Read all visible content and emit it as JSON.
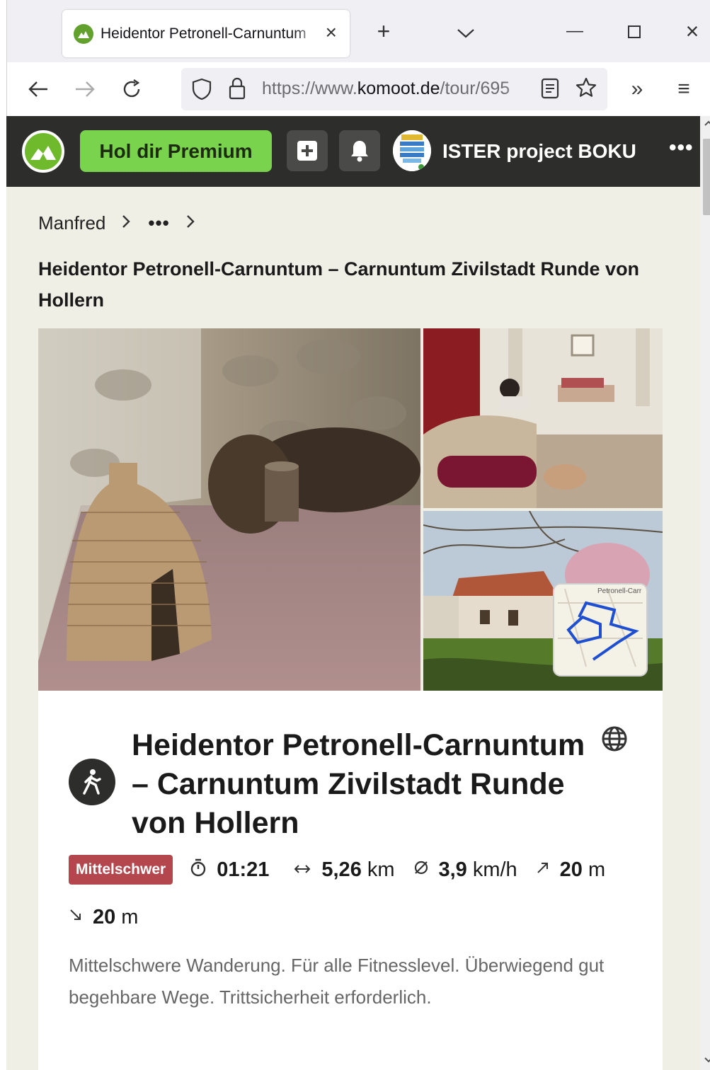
{
  "browser": {
    "tab_title": "Heidentor Petronell-Carnuntum",
    "tab_close": "×",
    "new_tab": "+",
    "list_tabs": "⌄",
    "minimize": "—",
    "maximize": "☐",
    "close": "×",
    "url_prefix": "https://www.",
    "url_domain": "komoot.de",
    "url_path": "/tour/695",
    "overflow": "»",
    "menu": "≡"
  },
  "header": {
    "premium_label": "Hol dir Premium",
    "user_name": "ISTER project BOKU",
    "more_label": "•••"
  },
  "breadcrumb": {
    "item1": "Manfred",
    "ellipsis": "•••"
  },
  "page_title": "Heidentor Petronell-Carnuntum – Carnuntum Zivilstadt Runde von Hollern",
  "map_label": "Petronell-Carr",
  "tour": {
    "title": "Heidentor Petronell-Carnuntum – Carnuntum Zivilstadt Runde von Hollern",
    "difficulty": "Mittelschwer",
    "duration_value": "01:21",
    "distance_value": "5,26",
    "distance_unit": "km",
    "speed_value": "3,9",
    "speed_unit": "km/h",
    "uphill_value": "20",
    "uphill_unit": "m",
    "downhill_value": "20",
    "downhill_unit": "m",
    "description": "Mittelschwere Wanderung. Für alle Fitnesslevel. Überwiegend gut begehbare Wege. Trittsicherheit erforderlich."
  },
  "colors": {
    "komoot_green": "#6fba2c",
    "premium_green": "#79d34d",
    "header_dark": "#2d2d2b",
    "difficulty_red": "#b3474d"
  }
}
